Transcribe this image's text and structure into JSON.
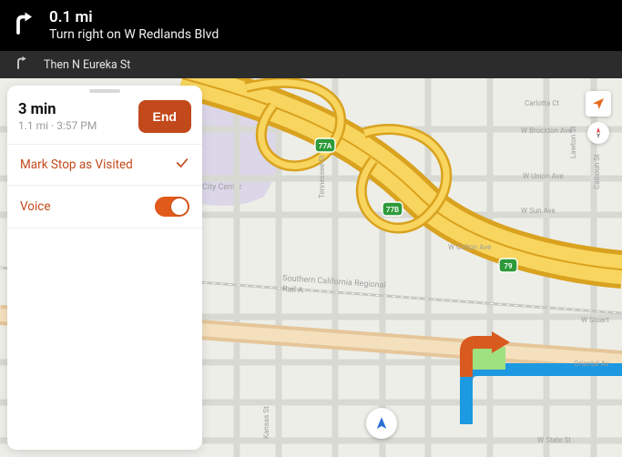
{
  "primary": {
    "distance": "0.1 mi",
    "instruction": "Turn right on W Redlands Blvd"
  },
  "secondary": {
    "instruction": "Then N Eureka St"
  },
  "panel": {
    "eta_duration": "3 min",
    "eta_sub": "1.1 mi  ·  3:57 PM",
    "end_label": "End",
    "mark_visited_label": "Mark Stop as Visited",
    "voice_label": "Voice",
    "voice_on": true
  },
  "map": {
    "labels": {
      "carlotta": "Carlotta Ct",
      "brockton": "W Brockton Ave",
      "lawton": "Lawton St",
      "union": "W Union Ave",
      "calhoun": "Calhoun St",
      "sun": "W Sun Ave",
      "colton": "W Colton Ave",
      "tennessee": "Tennessee St",
      "kansas": "Kansas St",
      "stuart": "W Stuart",
      "oriental": "Oriental Av",
      "state": "W State St",
      "scrra": "Southern California Regional",
      "scrra2": "Rail A",
      "citycenter": "City Center"
    },
    "shields": {
      "a77": "77A",
      "b77": "77B",
      "r79": "79"
    }
  }
}
